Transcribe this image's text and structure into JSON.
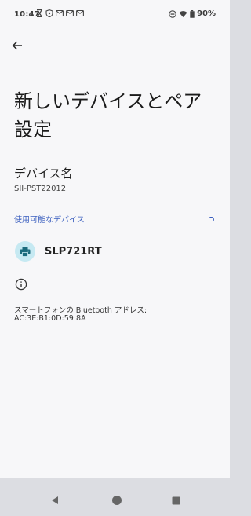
{
  "status_bar": {
    "time": "10:47",
    "battery_text": "90%",
    "icons_left": [
      "hourglass-icon",
      "shield-icon",
      "gmail-icon",
      "gmail-icon",
      "gmail-icon"
    ],
    "icons_right": [
      "do-not-disturb-icon",
      "wifi-icon",
      "battery-icon"
    ]
  },
  "header": {
    "back_icon": "arrow-left-icon",
    "title": "新しいデバイスとペア設定"
  },
  "device_name": {
    "label": "デバイス名",
    "value": "SII-PST22012"
  },
  "available_devices": {
    "header": "使用可能なデバイス",
    "items": [
      {
        "label": "SLP721RT",
        "icon": "printer-icon"
      }
    ]
  },
  "info": {
    "icon": "info-icon",
    "address_label": "スマートフォンの Bluetooth アドレス:",
    "address_value": "AC:3E:B1:0D:59:8A"
  },
  "nav": {
    "buttons": [
      "back-triangle-icon",
      "home-circle-icon",
      "recents-square-icon"
    ]
  },
  "colors": {
    "background": "#f7f7f9",
    "accent": "#3b5fbf",
    "device_icon_bg": "#c6e9f2",
    "device_icon_fg": "#1b6b7d"
  }
}
